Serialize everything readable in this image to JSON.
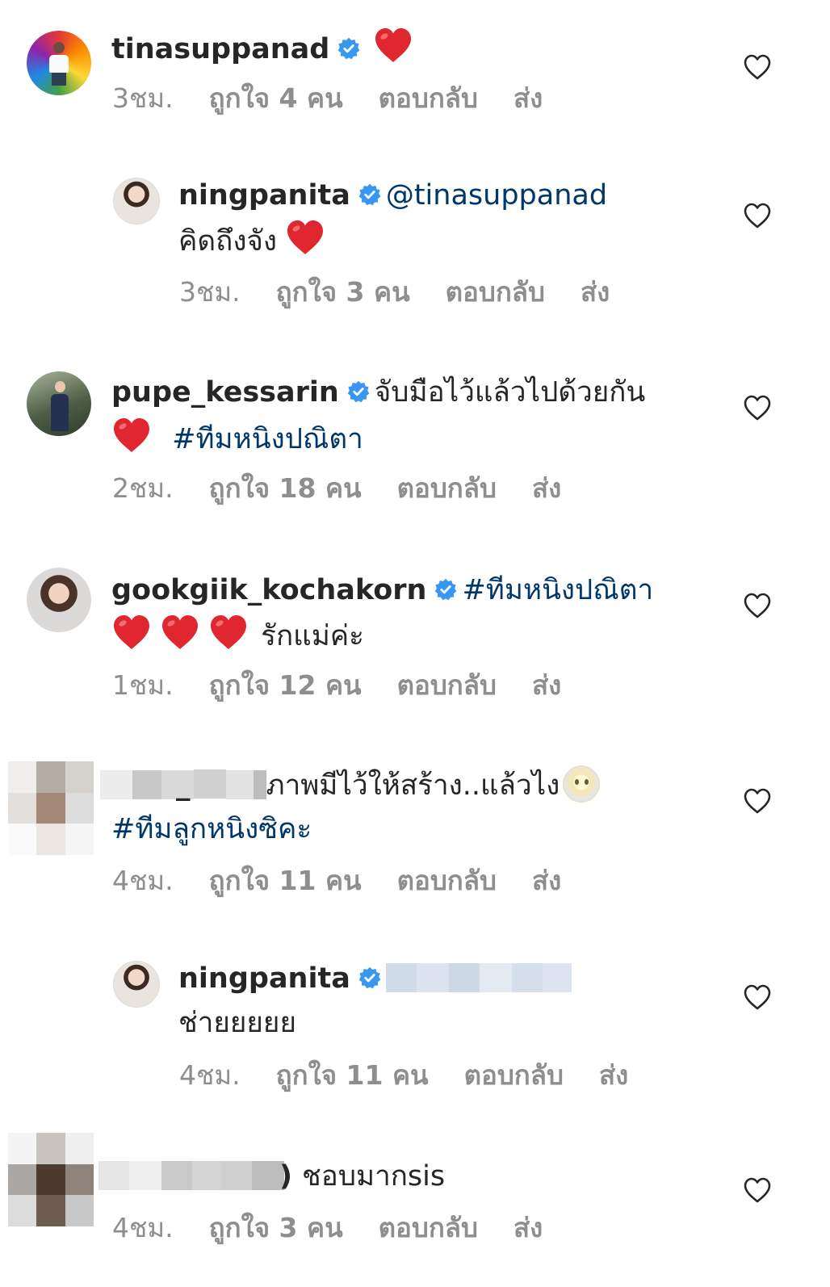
{
  "comments": [
    {
      "username": "tinasuppanad",
      "text": "",
      "time": "3ชม.",
      "likes": "ถูกใจ 4 คน",
      "reply": "ตอบกลับ",
      "send": "ส่ง",
      "avatar_icon": "rainbow-stairs-avatar"
    },
    {
      "username": "ningpanita",
      "mention": "@tinasuppanad",
      "text": "คิดถึงจัง",
      "time": "3ชม.",
      "likes": "ถูกใจ 3 คน",
      "reply": "ตอบกลับ",
      "send": "ส่ง"
    },
    {
      "username": "pupe_kessarin",
      "text": "จับมือไว้แล้วไปด้วยกัน",
      "hashtag": "#ทีมหนิงปณิตา",
      "time": "2ชม.",
      "likes": "ถูกใจ 18 คน",
      "reply": "ตอบกลับ",
      "send": "ส่ง"
    },
    {
      "username": "gookgiik_kochakorn",
      "hashtag": "#ทีมหนิงปณิตา",
      "text": "รักแม่ค่ะ",
      "time": "1ชม.",
      "likes": "ถูกใจ 12 คน",
      "reply": "ตอบกลับ",
      "send": "ส่ง"
    },
    {
      "username_censored": "_",
      "text": "ภาพมีไว้ให้สร้าง..แล้วไง",
      "hashtag": "#ทีมลูกหนิงซิคะ",
      "time": "4ชม.",
      "likes": "ถูกใจ 11 คน",
      "reply": "ตอบกลับ",
      "send": "ส่ง"
    },
    {
      "username": "ningpanita",
      "text": "ช่ายยยยย",
      "time": "4ชม.",
      "likes": "ถูกใจ 11 คน",
      "reply": "ตอบกลับ",
      "send": "ส่ง"
    },
    {
      "username_censored": ")",
      "text": "ชอบมากsis",
      "time": "4ชม.",
      "likes": "ถูกใจ 3 คน",
      "reply": "ตอบกลับ",
      "send": "ส่ง"
    }
  ],
  "colors": {
    "text": "#262626",
    "meta": "#8e8e8e",
    "hashtag": "#00376b",
    "verified": "#3897f0",
    "heart_emoji": "#e0262f"
  },
  "icons": {
    "verified": "verified-badge-icon",
    "like": "heart-outline-icon",
    "emoji_heart": "red-heart-emoji",
    "emoji_face": "mask-face-emoji"
  }
}
